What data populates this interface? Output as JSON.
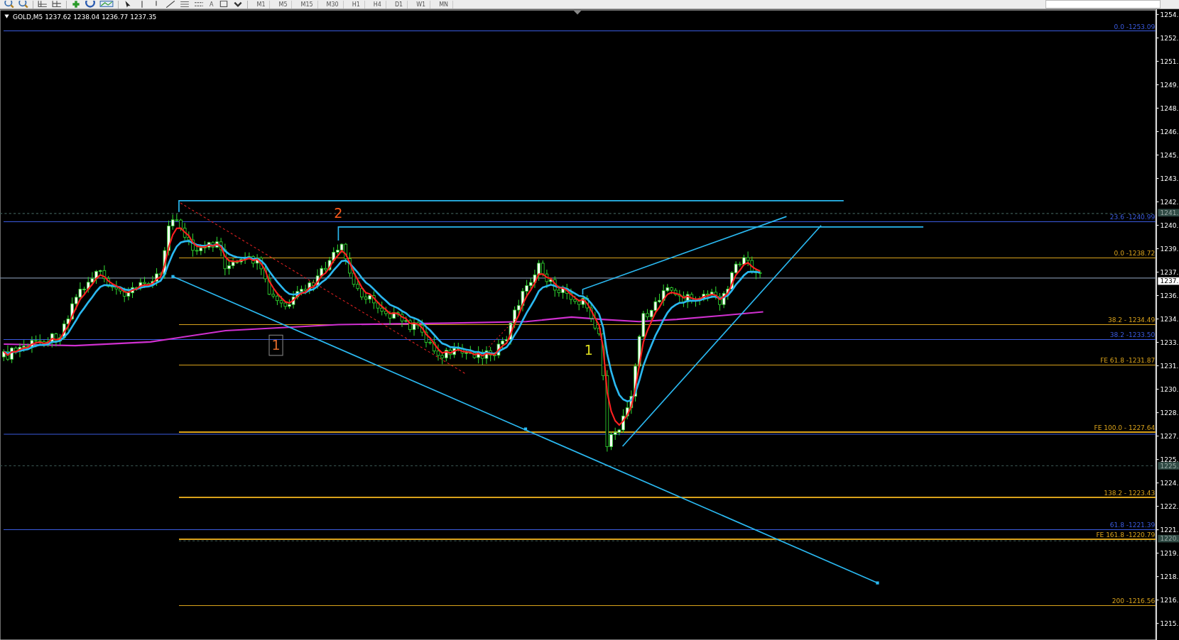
{
  "toolbar": {
    "text_tool": "A",
    "timeframes": [
      "M1",
      "M5",
      "M15",
      "M30",
      "H1",
      "H4",
      "D1",
      "W1",
      "MN"
    ]
  },
  "chart": {
    "header": "GOLD,M5  1237.62 1238.04 1236.77 1237.35",
    "levels": [
      {
        "text": "0.0 -1253.09",
        "color": "#3a5be0"
      },
      {
        "text": "23.6 -1240.99",
        "color": "#3a5be0"
      },
      {
        "text": "0.0 -1238.72",
        "color": "#d9a21b"
      },
      {
        "text": "38.2 - 1234.49",
        "color": "#d9a21b"
      },
      {
        "text": "38.2 -1233.50",
        "color": "#3a5be0"
      },
      {
        "text": "FE 61.8 -1231.87",
        "color": "#d9a21b"
      },
      {
        "text": "FE 100.0 - 1227.64",
        "color": "#d9a21b"
      },
      {
        "text": "138.2 - 1223.43",
        "color": "#d9a21b"
      },
      {
        "text": "61.8 -1221.39",
        "color": "#3a5be0"
      },
      {
        "text": "FE 161.8 -1220.79",
        "color": "#d9a21b"
      },
      {
        "text": "200 -1216.56",
        "color": "#d9a21b"
      }
    ],
    "wave_labels": [
      {
        "text": "2",
        "color": "#ff5a1a"
      },
      {
        "text": "1",
        "color": "#e06a2a"
      },
      {
        "text": "1",
        "color": "#e0e020"
      }
    ]
  },
  "price_axis": {
    "labels": [
      "1254.",
      "1252.",
      "1251.",
      "1249.",
      "1248.",
      "1246.",
      "1245.",
      "1243.",
      "1242.",
      "1240.",
      "1239.",
      "1237.",
      "1236.",
      "1234.",
      "1233.",
      "1231.",
      "1230.",
      "1228.",
      "1227.",
      "1225.",
      "1224.",
      "1222.",
      "1221.",
      "1219.",
      "1218.",
      "1216.",
      "1215."
    ],
    "markers": [
      {
        "text": "1241.",
        "kind": "level"
      },
      {
        "text": "1237.",
        "kind": "current"
      },
      {
        "text": "1225.",
        "kind": "level"
      },
      {
        "text": "1220.",
        "kind": "level"
      }
    ]
  }
}
